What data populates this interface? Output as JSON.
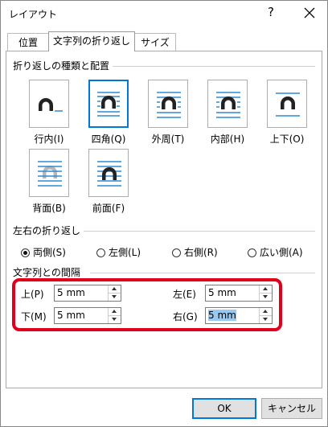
{
  "window": {
    "title": "レイアウト",
    "help": "?"
  },
  "tabs": [
    {
      "label": "位置",
      "active": false
    },
    {
      "label": "文字列の折り返し",
      "active": true
    },
    {
      "label": "サイズ",
      "active": false
    }
  ],
  "wrapping_style": {
    "title": "折り返しの種類と配置",
    "options": [
      {
        "label": "行内(I)",
        "icon": "inline-wrap-icon",
        "selected": false
      },
      {
        "label": "四角(Q)",
        "icon": "square-wrap-icon",
        "selected": true
      },
      {
        "label": "外周(T)",
        "icon": "tight-wrap-icon",
        "selected": false
      },
      {
        "label": "内部(H)",
        "icon": "through-wrap-icon",
        "selected": false
      },
      {
        "label": "上下(O)",
        "icon": "top-bottom-wrap-icon",
        "selected": false
      },
      {
        "label": "背面(B)",
        "icon": "behind-text-icon",
        "selected": false
      },
      {
        "label": "前面(F)",
        "icon": "in-front-text-icon",
        "selected": false
      }
    ]
  },
  "wrap_text": {
    "title": "左右の折り返し",
    "options": [
      {
        "label": "両側(S)",
        "checked": true
      },
      {
        "label": "左側(L)",
        "checked": false
      },
      {
        "label": "右側(R)",
        "checked": false
      },
      {
        "label": "広い側(A)",
        "checked": false
      }
    ]
  },
  "distance": {
    "title": "文字列との間隔",
    "top": {
      "label": "上(P)",
      "value": "5 mm"
    },
    "bottom": {
      "label": "下(M)",
      "value": "5 mm"
    },
    "left": {
      "label": "左(E)",
      "value": "5 mm"
    },
    "right": {
      "label": "右(G)",
      "value": "5 mm"
    }
  },
  "buttons": {
    "ok": "OK",
    "cancel": "キャンセル"
  },
  "colors": {
    "accent": "#0078d7",
    "highlight": "#e0001b",
    "icon_line": "#2e8bd0"
  }
}
